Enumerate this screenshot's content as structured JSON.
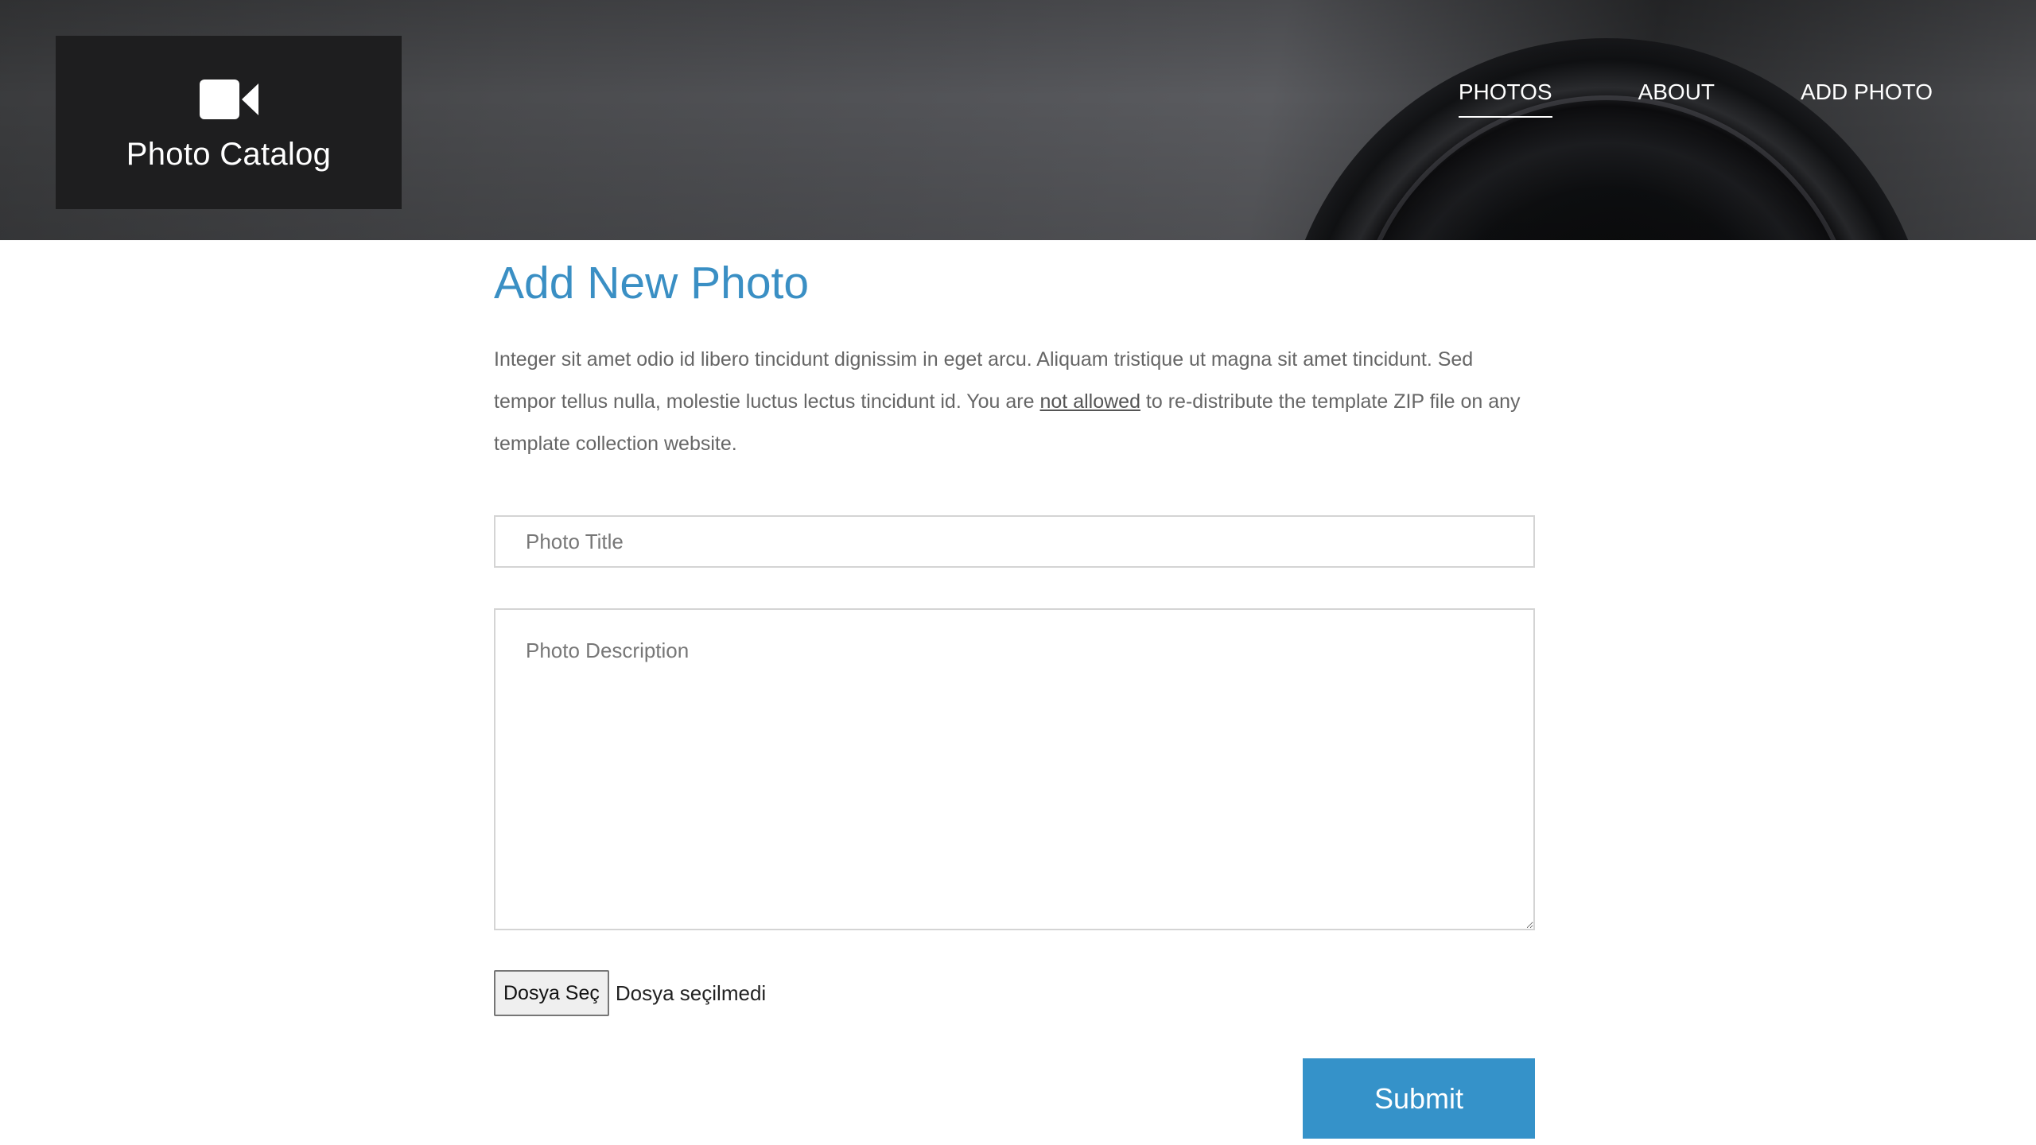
{
  "header": {
    "brand": {
      "icon": "video-camera-icon",
      "title": "Photo Catalog"
    },
    "nav": {
      "items": [
        {
          "label": "PHOTOS",
          "active": true
        },
        {
          "label": "ABOUT",
          "active": false
        },
        {
          "label": "ADD PHOTO",
          "active": false
        }
      ]
    }
  },
  "main": {
    "title": "Add New Photo",
    "intro": {
      "text_before": "Integer sit amet odio id libero tincidunt dignissim in eget arcu. Aliquam tristique ut magna sit amet tincidunt. Sed tempor tellus nulla, molestie luctus lectus tincidunt id. You are ",
      "link_text": "not allowed",
      "text_after": " to re-distribute the template ZIP file on any template collection website."
    },
    "form": {
      "title_input": {
        "placeholder": "Photo Title",
        "value": ""
      },
      "description_textarea": {
        "placeholder": "Photo Description",
        "value": ""
      },
      "file_input": {
        "button_label": "Dosya Seç",
        "status": "Dosya seçilmedi"
      },
      "submit_label": "Submit"
    }
  },
  "colors": {
    "accent": "#3592c9",
    "title": "#3a8fc4",
    "brand_box": "#1e1e1f"
  }
}
